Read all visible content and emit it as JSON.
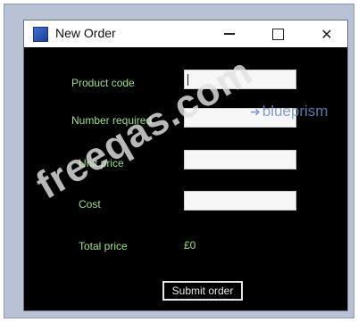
{
  "window": {
    "title": "New Order"
  },
  "form": {
    "product_code_label": "Product code",
    "product_code_value": "",
    "number_required_label": "Number required",
    "number_required_value": "",
    "unit_price_label": "Unit price",
    "unit_price_value": "",
    "cost_label": "Cost",
    "cost_value": "",
    "total_price_label": "Total price",
    "total_price_value": "£0",
    "submit_label": "Submit order"
  },
  "overlays": {
    "brand_text": "blueprism",
    "watermark_text": "freeqas.com"
  },
  "icons": {
    "app_icon": "app-icon",
    "minimize_icon": "minimize-icon",
    "maximize_icon": "maximize-icon",
    "close_icon": "close-icon",
    "brand_arrow_icon": "arrow-icon"
  },
  "colors": {
    "frame": "#b9c2d4",
    "window_bg": "#000000",
    "label_text": "#9ee08a",
    "field_bg": "#f7f7f7",
    "submit_border": "#e6e6e6",
    "brand": "#6f8fc9"
  }
}
